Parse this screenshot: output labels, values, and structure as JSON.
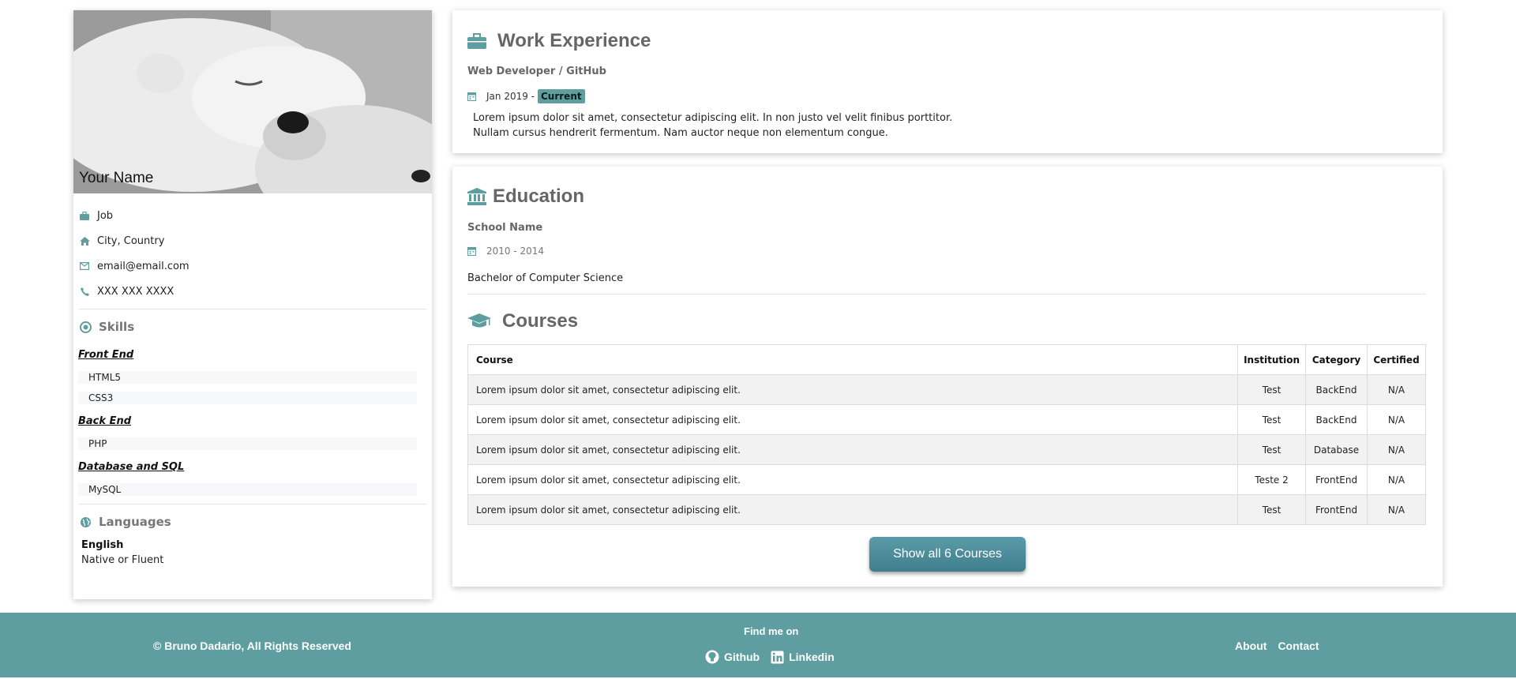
{
  "profile": {
    "name": "Your Name",
    "info": [
      {
        "icon": "briefcase-icon",
        "text": "Job"
      },
      {
        "icon": "home-icon",
        "text": "City, Country"
      },
      {
        "icon": "envelope-icon",
        "text": "email@email.com"
      },
      {
        "icon": "phone-icon",
        "text": "XXX XXX XXXX"
      }
    ],
    "skills_title": "Skills",
    "skills": [
      {
        "category": "Front End",
        "items": [
          "HTML5",
          "CSS3"
        ]
      },
      {
        "category": "Back End",
        "items": [
          "PHP"
        ]
      },
      {
        "category": "Database and SQL",
        "items": [
          "MySQL"
        ]
      }
    ],
    "languages_title": "Languages",
    "languages": [
      {
        "name": "English",
        "level": "Native or Fluent"
      }
    ]
  },
  "work": {
    "title": "Work Experience",
    "role": "Web Developer / GitHub",
    "date": "Jan 2019 -",
    "badge": "Current",
    "desc_line1": "Lorem ipsum dolor sit amet, consectetur adipiscing elit. In non justo vel velit finibus porttitor.",
    "desc_line2": "Nullam cursus hendrerit fermentum. Nam auctor neque non elementum congue."
  },
  "education": {
    "title": "Education",
    "school": "School Name",
    "date": "2010 - 2014",
    "degree": "Bachelor of Computer Science"
  },
  "courses": {
    "title": "Courses",
    "headers": [
      "Course",
      "Institution",
      "Category",
      "Certified"
    ],
    "rows": [
      [
        "Lorem ipsum dolor sit amet, consectetur adipiscing elit.",
        "Test",
        "BackEnd",
        "N/A"
      ],
      [
        "Lorem ipsum dolor sit amet, consectetur adipiscing elit.",
        "Test",
        "BackEnd",
        "N/A"
      ],
      [
        "Lorem ipsum dolor sit amet, consectetur adipiscing elit.",
        "Test",
        "Database",
        "N/A"
      ],
      [
        "Lorem ipsum dolor sit amet, consectetur adipiscing elit.",
        "Teste 2",
        "FrontEnd",
        "N/A"
      ],
      [
        "Lorem ipsum dolor sit amet, consectetur adipiscing elit.",
        "Test",
        "FrontEnd",
        "N/A"
      ]
    ],
    "button_label": "Show all 6 Courses"
  },
  "footer": {
    "copyright": "© Bruno Dadario, All Rights Reserved",
    "find_me": "Find me on",
    "github": "Github",
    "linkedin": "Linkedin",
    "about": "About",
    "contact": "Contact"
  },
  "colors": {
    "accent": "#5f9ea0",
    "button": "#4a8b98",
    "heading_gray": "#666666"
  }
}
